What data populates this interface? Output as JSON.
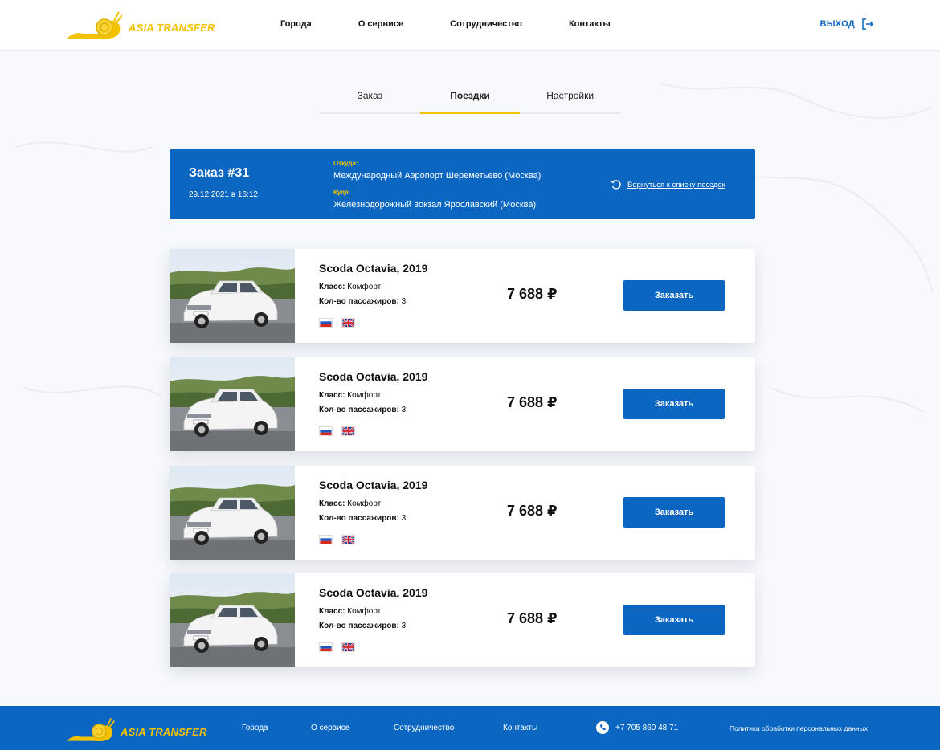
{
  "header": {
    "logo_text": "ASIA TRANSFER",
    "nav": [
      "Города",
      "О сервисе",
      "Сотрудничество",
      "Контакты"
    ],
    "logout_label": "ВЫХОД"
  },
  "tabs": [
    {
      "label": "Заказ",
      "active": false
    },
    {
      "label": "Поездки",
      "active": true
    },
    {
      "label": "Настройки",
      "active": false
    }
  ],
  "order": {
    "title": "Заказ #31",
    "date": "29.12.2021 в 16:12",
    "from_label": "Откуда:",
    "from_value": "Международный Аэропорт Шереметьево (Москва)",
    "to_label": "Куда:",
    "to_value": "Железнодорожный вокзал Ярославский (Москва)",
    "back_link": "Вернуться к списку поездок"
  },
  "cars": [
    {
      "name": "Scoda Octavia, 2019",
      "class_label": "Класс:",
      "class_value": "Комфорт",
      "pax_label": "Кол-во пассажиров:",
      "pax_value": "3",
      "price": "7 688 ₽",
      "button": "Заказать"
    },
    {
      "name": "Scoda Octavia, 2019",
      "class_label": "Класс:",
      "class_value": "Комфорт",
      "pax_label": "Кол-во пассажиров:",
      "pax_value": "3",
      "price": "7 688 ₽",
      "button": "Заказать"
    },
    {
      "name": "Scoda Octavia, 2019",
      "class_label": "Класс:",
      "class_value": "Комфорт",
      "pax_label": "Кол-во пассажиров:",
      "pax_value": "3",
      "price": "7 688 ₽",
      "button": "Заказать"
    },
    {
      "name": "Scoda Octavia, 2019",
      "class_label": "Класс:",
      "class_value": "Комфорт",
      "pax_label": "Кол-во пассажиров:",
      "pax_value": "3",
      "price": "7 688 ₽",
      "button": "Заказать"
    }
  ],
  "footer": {
    "logo_text": "ASIA TRANSFER",
    "nav": [
      "Города",
      "О сервисе",
      "Сотрудничество",
      "Контакты"
    ],
    "phone": "+7 705 860 48 71",
    "policy": "Политика обработки персональных данных"
  },
  "colors": {
    "brand_blue": "#0b66c2",
    "brand_yellow": "#f2c200"
  },
  "icons": [
    "snail-logo-icon",
    "logout-icon",
    "refresh-icon",
    "russia-flag-icon",
    "uk-flag-icon",
    "phone-icon"
  ]
}
